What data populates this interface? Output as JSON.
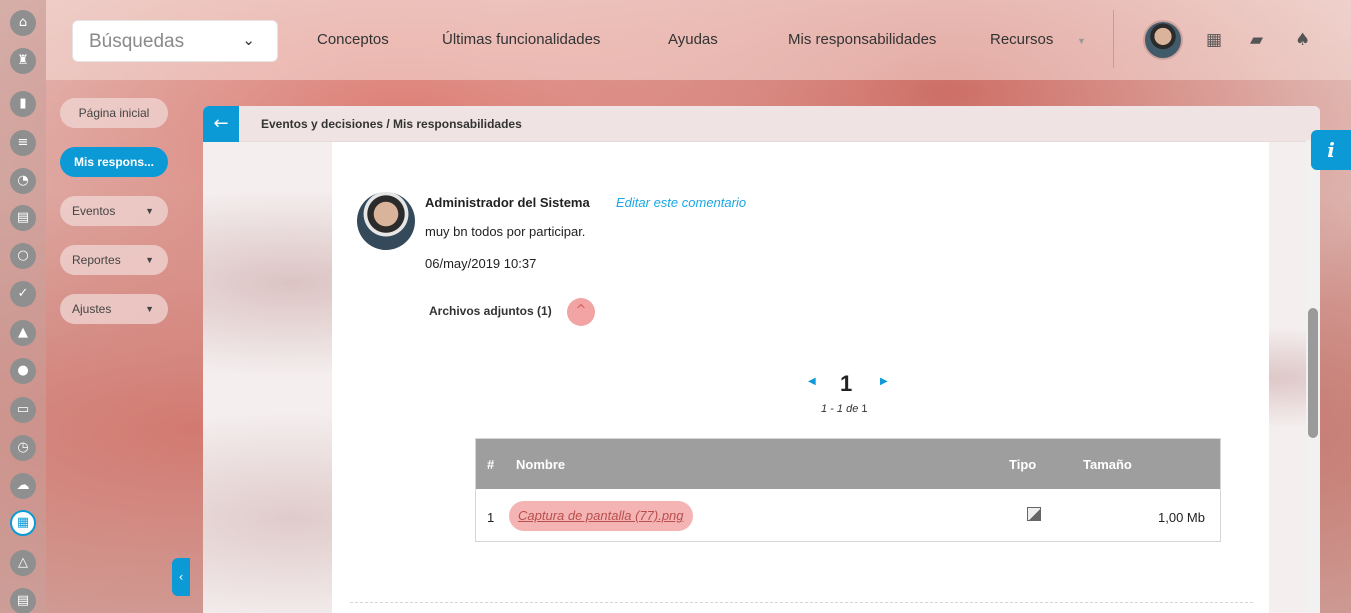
{
  "search": {
    "label": "Búsquedas"
  },
  "top_nav": [
    "Conceptos",
    "Últimas funcionalidades",
    "Ayudas",
    "Mis responsabilidades",
    "Recursos"
  ],
  "top_icons": [
    "calendar-icon",
    "briefcase-icon",
    "bell-icon"
  ],
  "rail_icons": [
    "home-icon",
    "chess-icon",
    "bar-chart-icon",
    "sliders-icon",
    "pie-chart-icon",
    "document-icon",
    "cycle-icon",
    "check-icon",
    "warning-icon",
    "chat-icon",
    "presentation-icon",
    "clock-icon",
    "cloud-icon",
    "calendar-icon",
    "network-icon",
    "list-icon"
  ],
  "menu": {
    "home": "Página inicial",
    "active": "Mis respons...",
    "events": "Eventos",
    "reports": "Reportes",
    "settings": "Ajustes"
  },
  "breadcrumb": "Eventos y decisiones / Mis responsabilidades",
  "comment": {
    "author": "Administrador del Sistema",
    "edit_link": "Editar este comentario",
    "text": "muy bn todos por participar.",
    "date": "06/may/2019 10:37"
  },
  "attachments": {
    "title": "Archivos adjuntos (1)",
    "pager": {
      "current": "1",
      "range": "1 - 1",
      "of_label": "de",
      "total": "1"
    },
    "columns": {
      "num": "#",
      "name": "Nombre",
      "type": "Tipo",
      "size": "Tamaño"
    },
    "rows": [
      {
        "num": "1",
        "name": "Captura de pantalla (77).png",
        "type_icon": "image-icon",
        "size": "1,00 Mb"
      }
    ]
  },
  "info_tab": "i",
  "colors": {
    "accent": "#0c9ad6",
    "highlight": "#f4b4b4",
    "table_header": "#9e9e9e"
  }
}
